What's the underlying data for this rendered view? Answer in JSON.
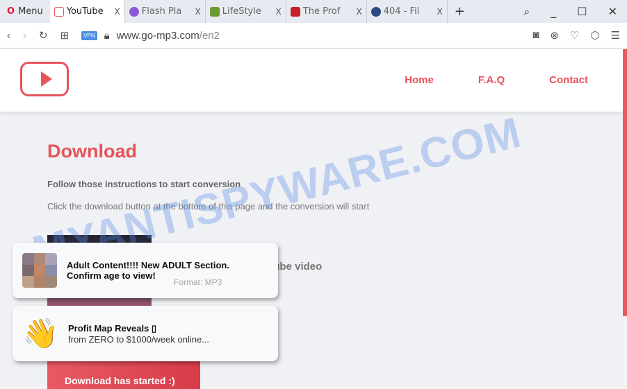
{
  "browser": {
    "menu": "Menu",
    "tabs": [
      {
        "label": "YouTube",
        "active": true,
        "color": "#e8525a"
      },
      {
        "label": "Flash Pla",
        "color": "#8a5bd6"
      },
      {
        "label": "LifeStyle",
        "color": "#6a9a30"
      },
      {
        "label": "The Prof",
        "color": "#c8202a"
      },
      {
        "label": "404 - Fil",
        "color": "#2a4a80"
      }
    ],
    "close": "X",
    "new_tab": "+",
    "vpn": "VPN",
    "url_host": "www.go-mp3.com",
    "url_path": "/en2"
  },
  "site": {
    "nav": [
      "Home",
      "F.A.Q",
      "Contact"
    ],
    "title": "Download",
    "subtitle": "Follow those instructions to start conversion",
    "description": "Click the download button at the bottom of this page and the conversion will start",
    "video_title": "YouTube video",
    "format": "Format: MP3",
    "download_button": "Download has started :)"
  },
  "watermark": "MYANTISPYWARE.COM",
  "notifications": [
    {
      "title": "Adult Content!!!! New ADULT Section.",
      "body": "Confirm age to view!",
      "icon": "pixelated-image"
    },
    {
      "title": "Profit Map Reveals ▯",
      "body": "from ZERO to $1000/week online...",
      "icon": "waving-hand"
    }
  ]
}
